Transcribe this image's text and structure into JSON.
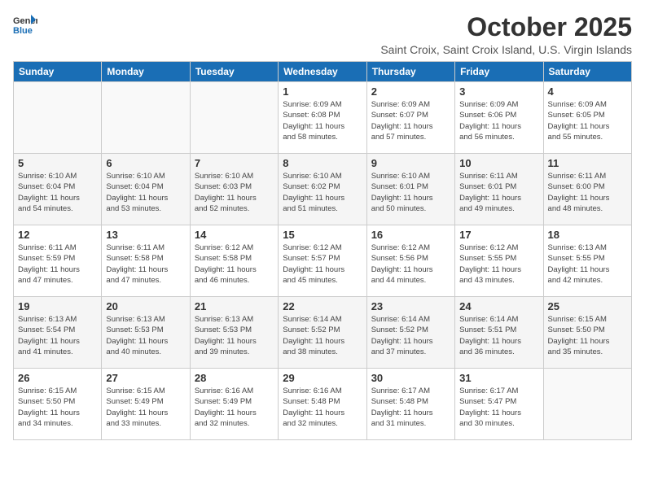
{
  "logo": {
    "general": "General",
    "blue": "Blue"
  },
  "header": {
    "month_title": "October 2025",
    "subtitle": "Saint Croix, Saint Croix Island, U.S. Virgin Islands"
  },
  "weekdays": [
    "Sunday",
    "Monday",
    "Tuesday",
    "Wednesday",
    "Thursday",
    "Friday",
    "Saturday"
  ],
  "weeks": [
    [
      {
        "day": "",
        "info": ""
      },
      {
        "day": "",
        "info": ""
      },
      {
        "day": "",
        "info": ""
      },
      {
        "day": "1",
        "info": "Sunrise: 6:09 AM\nSunset: 6:08 PM\nDaylight: 11 hours\nand 58 minutes."
      },
      {
        "day": "2",
        "info": "Sunrise: 6:09 AM\nSunset: 6:07 PM\nDaylight: 11 hours\nand 57 minutes."
      },
      {
        "day": "3",
        "info": "Sunrise: 6:09 AM\nSunset: 6:06 PM\nDaylight: 11 hours\nand 56 minutes."
      },
      {
        "day": "4",
        "info": "Sunrise: 6:09 AM\nSunset: 6:05 PM\nDaylight: 11 hours\nand 55 minutes."
      }
    ],
    [
      {
        "day": "5",
        "info": "Sunrise: 6:10 AM\nSunset: 6:04 PM\nDaylight: 11 hours\nand 54 minutes."
      },
      {
        "day": "6",
        "info": "Sunrise: 6:10 AM\nSunset: 6:04 PM\nDaylight: 11 hours\nand 53 minutes."
      },
      {
        "day": "7",
        "info": "Sunrise: 6:10 AM\nSunset: 6:03 PM\nDaylight: 11 hours\nand 52 minutes."
      },
      {
        "day": "8",
        "info": "Sunrise: 6:10 AM\nSunset: 6:02 PM\nDaylight: 11 hours\nand 51 minutes."
      },
      {
        "day": "9",
        "info": "Sunrise: 6:10 AM\nSunset: 6:01 PM\nDaylight: 11 hours\nand 50 minutes."
      },
      {
        "day": "10",
        "info": "Sunrise: 6:11 AM\nSunset: 6:01 PM\nDaylight: 11 hours\nand 49 minutes."
      },
      {
        "day": "11",
        "info": "Sunrise: 6:11 AM\nSunset: 6:00 PM\nDaylight: 11 hours\nand 48 minutes."
      }
    ],
    [
      {
        "day": "12",
        "info": "Sunrise: 6:11 AM\nSunset: 5:59 PM\nDaylight: 11 hours\nand 47 minutes."
      },
      {
        "day": "13",
        "info": "Sunrise: 6:11 AM\nSunset: 5:58 PM\nDaylight: 11 hours\nand 47 minutes."
      },
      {
        "day": "14",
        "info": "Sunrise: 6:12 AM\nSunset: 5:58 PM\nDaylight: 11 hours\nand 46 minutes."
      },
      {
        "day": "15",
        "info": "Sunrise: 6:12 AM\nSunset: 5:57 PM\nDaylight: 11 hours\nand 45 minutes."
      },
      {
        "day": "16",
        "info": "Sunrise: 6:12 AM\nSunset: 5:56 PM\nDaylight: 11 hours\nand 44 minutes."
      },
      {
        "day": "17",
        "info": "Sunrise: 6:12 AM\nSunset: 5:55 PM\nDaylight: 11 hours\nand 43 minutes."
      },
      {
        "day": "18",
        "info": "Sunrise: 6:13 AM\nSunset: 5:55 PM\nDaylight: 11 hours\nand 42 minutes."
      }
    ],
    [
      {
        "day": "19",
        "info": "Sunrise: 6:13 AM\nSunset: 5:54 PM\nDaylight: 11 hours\nand 41 minutes."
      },
      {
        "day": "20",
        "info": "Sunrise: 6:13 AM\nSunset: 5:53 PM\nDaylight: 11 hours\nand 40 minutes."
      },
      {
        "day": "21",
        "info": "Sunrise: 6:13 AM\nSunset: 5:53 PM\nDaylight: 11 hours\nand 39 minutes."
      },
      {
        "day": "22",
        "info": "Sunrise: 6:14 AM\nSunset: 5:52 PM\nDaylight: 11 hours\nand 38 minutes."
      },
      {
        "day": "23",
        "info": "Sunrise: 6:14 AM\nSunset: 5:52 PM\nDaylight: 11 hours\nand 37 minutes."
      },
      {
        "day": "24",
        "info": "Sunrise: 6:14 AM\nSunset: 5:51 PM\nDaylight: 11 hours\nand 36 minutes."
      },
      {
        "day": "25",
        "info": "Sunrise: 6:15 AM\nSunset: 5:50 PM\nDaylight: 11 hours\nand 35 minutes."
      }
    ],
    [
      {
        "day": "26",
        "info": "Sunrise: 6:15 AM\nSunset: 5:50 PM\nDaylight: 11 hours\nand 34 minutes."
      },
      {
        "day": "27",
        "info": "Sunrise: 6:15 AM\nSunset: 5:49 PM\nDaylight: 11 hours\nand 33 minutes."
      },
      {
        "day": "28",
        "info": "Sunrise: 6:16 AM\nSunset: 5:49 PM\nDaylight: 11 hours\nand 32 minutes."
      },
      {
        "day": "29",
        "info": "Sunrise: 6:16 AM\nSunset: 5:48 PM\nDaylight: 11 hours\nand 32 minutes."
      },
      {
        "day": "30",
        "info": "Sunrise: 6:17 AM\nSunset: 5:48 PM\nDaylight: 11 hours\nand 31 minutes."
      },
      {
        "day": "31",
        "info": "Sunrise: 6:17 AM\nSunset: 5:47 PM\nDaylight: 11 hours\nand 30 minutes."
      },
      {
        "day": "",
        "info": ""
      }
    ]
  ]
}
